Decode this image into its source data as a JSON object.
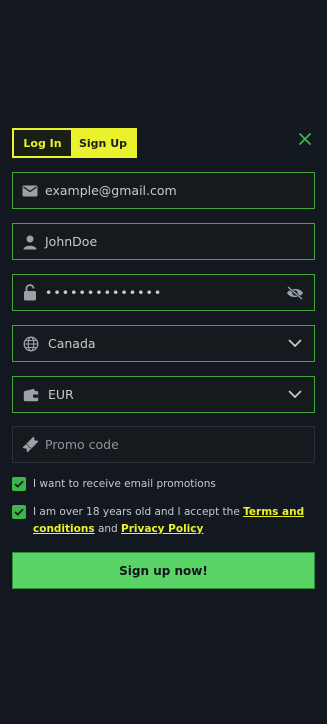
{
  "tabs": {
    "login": "Log In",
    "signup": "Sign Up"
  },
  "colors": {
    "accent": "#e9f22a",
    "green_border": "#43a63b",
    "button": "#5bd467",
    "background": "#13171f"
  },
  "fields": {
    "email": {
      "value": "example@gmail.com",
      "icon": "mail-icon"
    },
    "username": {
      "value": "JohnDoe",
      "icon": "user-icon"
    },
    "password": {
      "value": "••••••••••••••",
      "icon": "lock-icon",
      "trail_icon": "eye-off-icon"
    },
    "country": {
      "value": "Canada",
      "icon": "globe-icon",
      "trail_icon": "chevron-down-icon"
    },
    "currency": {
      "value": "EUR",
      "icon": "wallet-icon",
      "trail_icon": "chevron-down-icon"
    },
    "promo": {
      "placeholder": "Promo code",
      "icon": "ticket-icon"
    }
  },
  "checks": {
    "promotions": "I want to receive email promotions",
    "age_prefix": "I am over 18 years old and I accept the",
    "terms_link": "Terms and conditions",
    "and": "and",
    "privacy_link": "Privacy Policy"
  },
  "submit_label": "Sign up now!"
}
